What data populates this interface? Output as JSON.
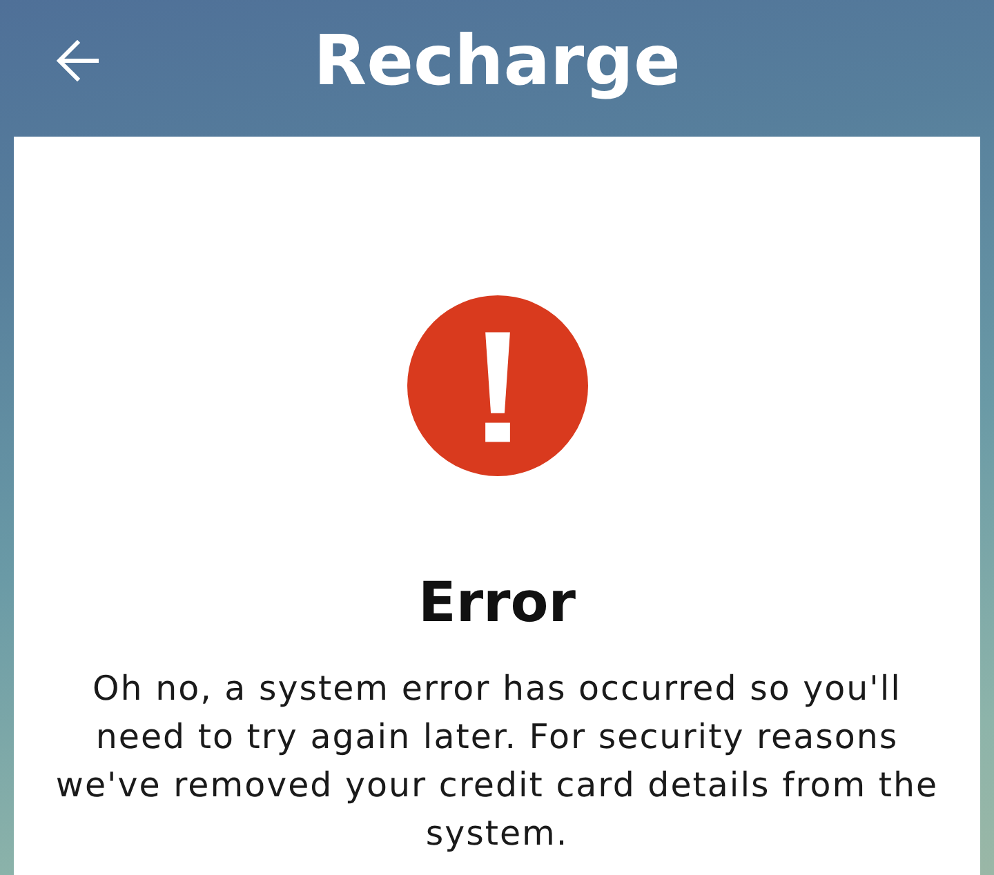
{
  "header": {
    "title": "Recharge"
  },
  "error": {
    "heading": "Error",
    "message": "Oh no, a system error has occurred so you'll need to try again later. For security reasons we've removed your credit card details from the system."
  }
}
